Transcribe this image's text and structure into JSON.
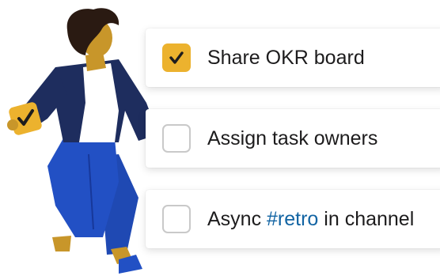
{
  "checklist": {
    "items": [
      {
        "label": "Share OKR board",
        "checked": true
      },
      {
        "label": "Assign task owners",
        "checked": false
      },
      {
        "prefix": "Async ",
        "hashtag": "#retro",
        "suffix": " in channel",
        "checked": false
      }
    ]
  },
  "colors": {
    "checkbox_checked": "#ecb22e",
    "hashtag_link": "#1264a3",
    "jacket": "#1e2d5e",
    "pants": "#2250c4",
    "skin": "#c8962a",
    "hair": "#2a1a12"
  },
  "illustration": {
    "subject": "person-walking-holding-checkmark-card",
    "icon": "checkmark-icon"
  }
}
